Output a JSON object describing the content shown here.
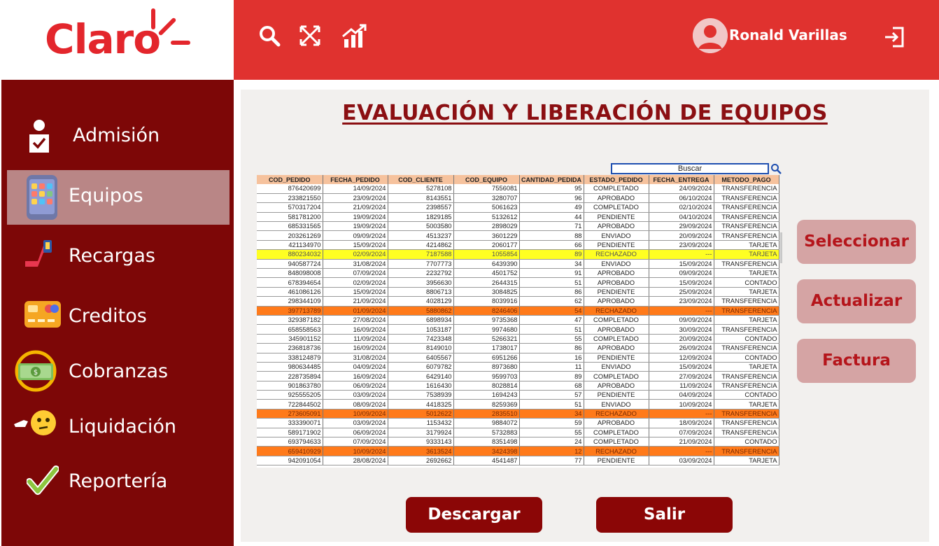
{
  "brand": {
    "name": "Claro",
    "color": "#e3262c"
  },
  "header": {
    "icons": [
      "search-icon",
      "crossed-arrows-icon",
      "growth-chart-icon"
    ],
    "user_name": "Ronald Varillas",
    "logout_icon": "logout-icon"
  },
  "sidebar": {
    "items": [
      {
        "label": "Admisión",
        "icon": "admission-person-icon",
        "active": false
      },
      {
        "label": "Equipos",
        "icon": "phone-device-icon",
        "active": true
      },
      {
        "label": "Recargas",
        "icon": "recharge-hand-icon",
        "active": false
      },
      {
        "label": "Creditos",
        "icon": "credit-card-icon",
        "active": false
      },
      {
        "label": "Cobranzas",
        "icon": "money-bill-icon",
        "active": false
      },
      {
        "label": "Liquidación",
        "icon": "thinking-face-icon",
        "active": false
      },
      {
        "label": "Reportería",
        "icon": "check-mark-icon",
        "active": false
      }
    ]
  },
  "main": {
    "title": "EVALUACIÓN Y LIBERACIÓN DE EQUIPOS",
    "search_label": "Buscar",
    "table": {
      "columns": [
        "COD_PEDIDO",
        "FECHA_PEDIDO",
        "COD_CLIENTE",
        "COD_EQUIPO",
        "CANTIDAD_PEDIDA",
        "ESTADO_PEDIDO",
        "FECHA_ENTREGA",
        "METODO_PAGO"
      ],
      "rows": [
        [
          "876420699",
          "14/09/2024",
          "5278108",
          "7556081",
          "95",
          "COMPLETADO",
          "24/09/2024",
          "TRANSFERENCIA"
        ],
        [
          "233821550",
          "23/09/2024",
          "8143551",
          "3280707",
          "96",
          "APROBADO",
          "06/10/2024",
          "TRANSFERENCIA"
        ],
        [
          "570317204",
          "21/09/2024",
          "2398557",
          "5061623",
          "49",
          "COMPLETADO",
          "02/10/2024",
          "TRANSFERENCIA"
        ],
        [
          "581781200",
          "19/09/2024",
          "1829185",
          "5132612",
          "44",
          "PENDIENTE",
          "04/10/2024",
          "TRANSFERENCIA"
        ],
        [
          "685331565",
          "19/09/2024",
          "5003580",
          "2898029",
          "71",
          "APROBADO",
          "29/09/2024",
          "TRANSFERENCIA"
        ],
        [
          "203261269",
          "09/09/2024",
          "4513237",
          "3601229",
          "88",
          "ENVIADO",
          "20/09/2024",
          "TRANSFERENCIA"
        ],
        [
          "421134970",
          "15/09/2024",
          "4214862",
          "2060177",
          "66",
          "PENDIENTE",
          "23/09/2024",
          "TARJETA"
        ],
        [
          "880234032",
          "02/09/2024",
          "7187588",
          "1055854",
          "89",
          "RECHAZADO",
          "---",
          "TARJETA"
        ],
        [
          "940587724",
          "31/08/2024",
          "7707773",
          "6439390",
          "34",
          "ENVIADO",
          "15/09/2024",
          "TRANSFERENCIA"
        ],
        [
          "848098008",
          "07/09/2024",
          "2232792",
          "4501752",
          "91",
          "APROBADO",
          "09/09/2024",
          "TARJETA"
        ],
        [
          "678394654",
          "02/09/2024",
          "3956630",
          "2644315",
          "51",
          "APROBADO",
          "15/09/2024",
          "CONTADO"
        ],
        [
          "461086126",
          "15/09/2024",
          "8806713",
          "3084825",
          "86",
          "PENDIENTE",
          "25/09/2024",
          "TARJETA"
        ],
        [
          "298344109",
          "21/09/2024",
          "4028129",
          "8039916",
          "62",
          "APROBADO",
          "23/09/2024",
          "TRANSFERENCIA"
        ],
        [
          "397713789",
          "01/09/2024",
          "5880862",
          "8246406",
          "54",
          "RECHAZADO",
          "---",
          "TRANSFERENCIA"
        ],
        [
          "329387182",
          "27/08/2024",
          "6898934",
          "9735368",
          "47",
          "COMPLETADO",
          "09/09/2024",
          "TARJETA"
        ],
        [
          "658558563",
          "16/09/2024",
          "1053187",
          "9974680",
          "51",
          "APROBADO",
          "30/09/2024",
          "TRANSFERENCIA"
        ],
        [
          "345901152",
          "11/09/2024",
          "7423348",
          "5266321",
          "55",
          "COMPLETADO",
          "20/09/2024",
          "CONTADO"
        ],
        [
          "236818736",
          "16/09/2024",
          "8149010",
          "1738017",
          "86",
          "APROBADO",
          "26/09/2024",
          "TRANSFERENCIA"
        ],
        [
          "338124879",
          "31/08/2024",
          "6405567",
          "6951266",
          "16",
          "PENDIENTE",
          "12/09/2024",
          "CONTADO"
        ],
        [
          "980634485",
          "04/09/2024",
          "6079782",
          "8973680",
          "11",
          "ENVIADO",
          "15/09/2024",
          "TARJETA"
        ],
        [
          "228735894",
          "16/09/2024",
          "6429140",
          "9599703",
          "89",
          "COMPLETADO",
          "27/09/2024",
          "TRANSFERENCIA"
        ],
        [
          "901863780",
          "06/09/2024",
          "1616430",
          "8028814",
          "68",
          "APROBADO",
          "11/09/2024",
          "TRANSFERENCIA"
        ],
        [
          "925555205",
          "03/09/2024",
          "7538939",
          "1694243",
          "57",
          "PENDIENTE",
          "04/09/2024",
          "CONTADO"
        ],
        [
          "722844502",
          "08/09/2024",
          "4418325",
          "8259369",
          "51",
          "ENVIADO",
          "10/09/2024",
          "TARJETA"
        ],
        [
          "273605091",
          "10/09/2024",
          "5012622",
          "2835510",
          "34",
          "RECHAZADO",
          "---",
          "TRANSFERENCIA"
        ],
        [
          "333390071",
          "03/09/2024",
          "1153432",
          "9884072",
          "59",
          "APROBADO",
          "18/09/2024",
          "TRANSFERENCIA"
        ],
        [
          "589171902",
          "06/09/2024",
          "3179924",
          "5732883",
          "55",
          "COMPLETADO",
          "07/09/2024",
          "TRANSFERENCIA"
        ],
        [
          "693794633",
          "07/09/2024",
          "9333143",
          "8351498",
          "24",
          "COMPLETADO",
          "21/09/2024",
          "CONTADO"
        ],
        [
          "659410929",
          "10/09/2024",
          "3613524",
          "3424398",
          "12",
          "RECHAZADO",
          "---",
          "TRANSFERENCIA"
        ],
        [
          "942091054",
          "28/08/2024",
          "2692662",
          "4541487",
          "77",
          "PENDIENTE",
          "03/09/2024",
          "TARJETA"
        ]
      ],
      "highlight_colors": {
        "selected": "#ffff22",
        "rejected": "#ff7a1a"
      }
    },
    "actions": [
      "Seleccionar",
      "Actualizar",
      "Factura"
    ],
    "bottom_buttons": {
      "download": "Descargar",
      "exit": "Salir"
    }
  },
  "colors": {
    "header_red": "#e0322f",
    "sidebar_dark": "#7d0707",
    "accent_dark": "#8b0606",
    "action_bg": "#d5a4a4"
  }
}
